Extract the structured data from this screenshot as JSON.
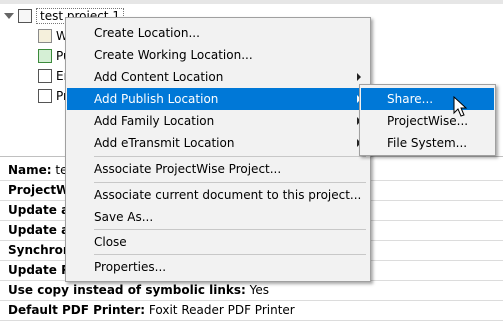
{
  "tree": {
    "root": {
      "label": "test project 1"
    },
    "children": [
      {
        "label": "W",
        "icon": "folder-icon"
      },
      {
        "label": "Pu",
        "icon": "publish-icon"
      },
      {
        "label": "Er",
        "icon": "document-icon"
      },
      {
        "label": "Pr",
        "icon": "document-icon"
      }
    ]
  },
  "properties": [
    {
      "label": "Name:",
      "value": "test"
    },
    {
      "label": "ProjectWis",
      "value": ""
    },
    {
      "label": "Update att",
      "value": ""
    },
    {
      "label": "Update att",
      "value": ""
    },
    {
      "label": "Synchroniz",
      "value": ""
    },
    {
      "label": "Update Pro",
      "value": ""
    },
    {
      "label": "Use copy instead of symbolic links:",
      "value": "Yes"
    },
    {
      "label": "Default PDF Printer:",
      "value": "Foxit Reader PDF Printer"
    }
  ],
  "context_menu": {
    "items": [
      {
        "label": "Create Location...",
        "has_submenu": false
      },
      {
        "label": "Create Working Location...",
        "has_submenu": false
      },
      {
        "label": "Add Content Location",
        "has_submenu": true
      },
      {
        "label": "Add Publish Location",
        "has_submenu": true,
        "highlighted": true
      },
      {
        "label": "Add Family Location",
        "has_submenu": true
      },
      {
        "label": "Add eTransmit Location",
        "has_submenu": true
      },
      {
        "label": "Associate ProjectWise Project...",
        "has_submenu": false
      },
      {
        "label": "Associate current document to this project...",
        "has_submenu": false
      },
      {
        "label": "Save As...",
        "has_submenu": false
      },
      {
        "label": "Close",
        "has_submenu": false
      },
      {
        "label": "Properties...",
        "has_submenu": false
      }
    ]
  },
  "submenu": {
    "items": [
      {
        "label": "Share...",
        "highlighted": true
      },
      {
        "label": "ProjectWise..."
      },
      {
        "label": "File System..."
      }
    ]
  },
  "colors": {
    "highlight": "#0078d7",
    "menu_bg": "#f2f2f2"
  }
}
